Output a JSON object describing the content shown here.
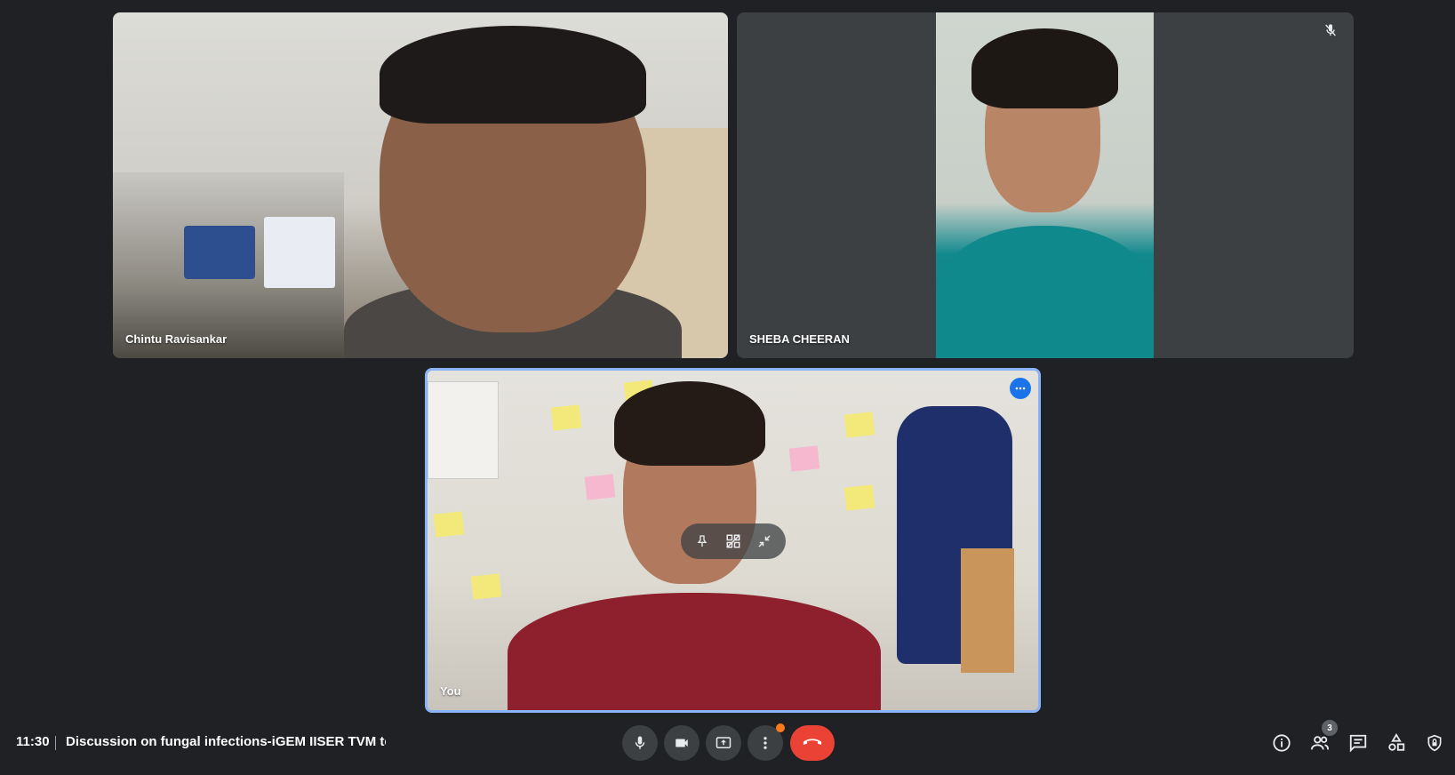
{
  "participants": [
    {
      "name": "Chintu Ravisankar",
      "muted": false
    },
    {
      "name": "SHEBA CHEERAN",
      "muted": true
    },
    {
      "name": "You",
      "muted": false,
      "self": true
    }
  ],
  "tile_icons": {
    "mute": "mic-off-icon",
    "more": "more-options-icon",
    "pin": "pin-icon",
    "remove_from_grid": "remove-from-grid-icon",
    "minimize": "minimize-icon"
  },
  "bottom_bar": {
    "time": "11:30",
    "meeting_title": "Discussion on fungal infections-iGEM IISER TVM tea...",
    "controls": [
      "mic-icon",
      "camera-icon",
      "present-screen-icon",
      "more-options-icon",
      "end-call-icon"
    ],
    "right_icons": [
      "info-icon",
      "people-icon",
      "chat-icon",
      "activities-icon",
      "host-controls-icon"
    ],
    "people_count": "3"
  },
  "colors": {
    "background": "#202124",
    "tile": "#3c4043",
    "active_border": "#8ab4f8",
    "end_call": "#ea4335",
    "notification_dot": "#fa7b17"
  }
}
